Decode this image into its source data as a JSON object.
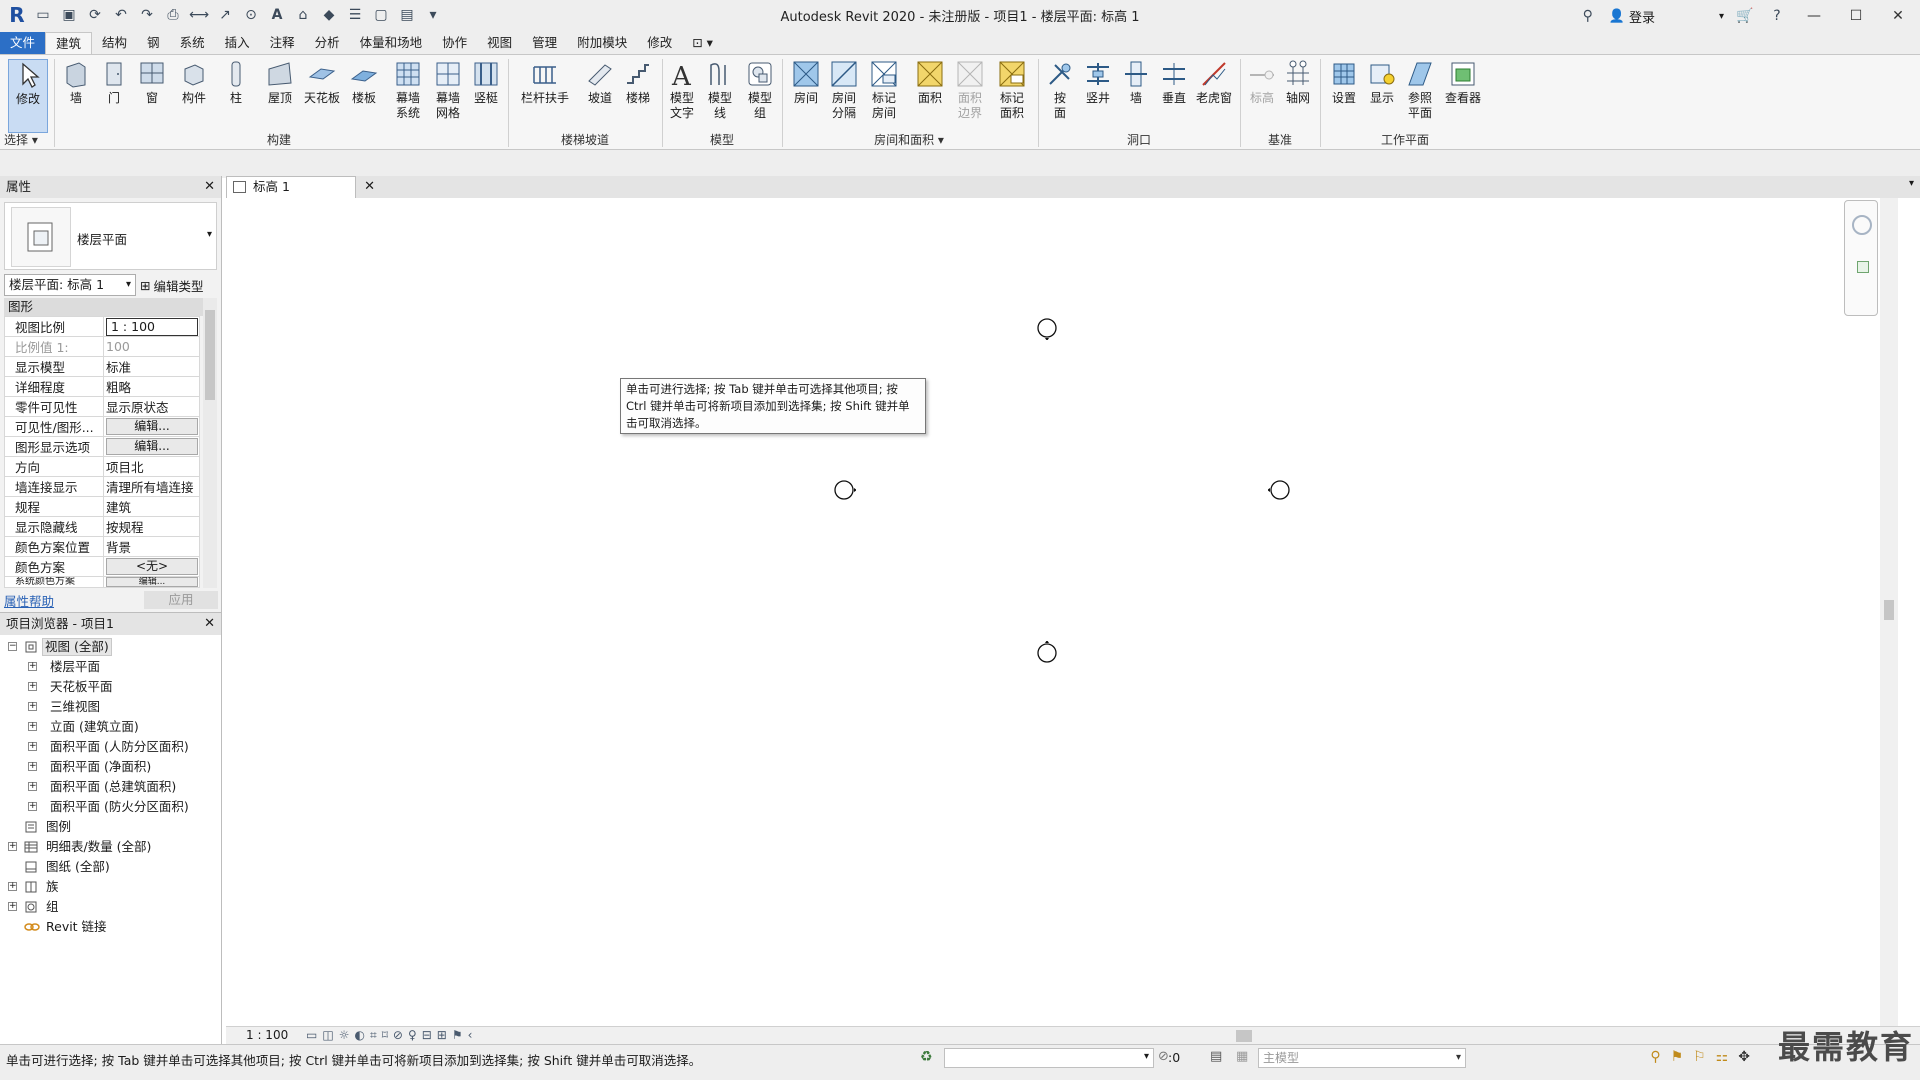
{
  "titlebar": {
    "title": "Autodesk Revit 2020 - 未注册版 - 项目1 - 楼层平面: 标高 1",
    "login": "登录"
  },
  "tabs": [
    "文件",
    "建筑",
    "结构",
    "钢",
    "系统",
    "插入",
    "注释",
    "分析",
    "体量和场地",
    "协作",
    "视图",
    "管理",
    "附加模块",
    "修改"
  ],
  "ribbon": {
    "modify": "修改",
    "select": "选择 ▾",
    "buttons": {
      "wall": "墙",
      "door": "门",
      "window": "窗",
      "component": "构件",
      "column": "柱",
      "roof": "屋顶",
      "ceiling": "天花板",
      "floor": "楼板",
      "curtain_system_1": "幕墙",
      "curtain_system_2": "系统",
      "curtain_grid_1": "幕墙",
      "curtain_grid_2": "网格",
      "mullion": "竖梃",
      "railing": "栏杆扶手",
      "ramp": "坡道",
      "stair": "楼梯",
      "model_text_1": "模型",
      "model_text_2": "文字",
      "model_line_1": "模型",
      "model_line_2": "线",
      "model_group_1": "模型",
      "model_group_2": "组",
      "room": "房间",
      "room_sep_1": "房间",
      "room_sep_2": "分隔",
      "tag_room_1": "标记",
      "tag_room_2": "房间",
      "area": "面积",
      "area_boundary_1": "面积",
      "area_boundary_2": "边界",
      "tag_area_1": "标记",
      "tag_area_2": "面积",
      "by_face_1": "按",
      "by_face_2": "面",
      "shaft": "竖井",
      "wall_opening": "墙",
      "vertical": "垂直",
      "dormer": "老虎窗",
      "level": "标高",
      "grid": "轴网",
      "set": "设置",
      "show": "显示",
      "ref_plane_1": "参照",
      "ref_plane_2": "平面",
      "viewer": "查看器"
    },
    "groups": {
      "build": "构建",
      "circulation": "楼梯坡道",
      "model": "模型",
      "room_area": "房间和面积 ▾",
      "opening": "洞口",
      "datum": "基准",
      "work_plane": "工作平面"
    }
  },
  "properties": {
    "title": "属性",
    "type_name": "楼层平面",
    "instance": "楼层平面: 标高 1",
    "edit_type": "编辑类型",
    "category": "图形",
    "rows": [
      {
        "label": "视图比例",
        "value": "1 : 100"
      },
      {
        "label": "比例值 1:",
        "value": "100"
      },
      {
        "label": "显示模型",
        "value": "标准"
      },
      {
        "label": "详细程度",
        "value": "粗略"
      },
      {
        "label": "零件可见性",
        "value": "显示原状态"
      },
      {
        "label": "可见性/图形...",
        "value": "编辑..."
      },
      {
        "label": "图形显示选项",
        "value": "编辑..."
      },
      {
        "label": "方向",
        "value": "项目北"
      },
      {
        "label": "墙连接显示",
        "value": "清理所有墙连接"
      },
      {
        "label": "规程",
        "value": "建筑"
      },
      {
        "label": "显示隐藏线",
        "value": "按规程"
      },
      {
        "label": "颜色方案位置",
        "value": "背景"
      },
      {
        "label": "颜色方案",
        "value": "<无>"
      },
      {
        "label": "系统颜色方案",
        "value": "编辑..."
      }
    ],
    "help": "属性帮助",
    "apply": "应用"
  },
  "browser": {
    "title": "项目浏览器 - 项目1",
    "root": "视图 (全部)",
    "views": [
      "楼层平面",
      "天花板平面",
      "三维视图",
      "立面 (建筑立面)",
      "面积平面 (人防分区面积)",
      "面积平面 (净面积)",
      "面积平面 (总建筑面积)",
      "面积平面 (防火分区面积)"
    ],
    "legend": "图例",
    "schedules": "明细表/数量 (全部)",
    "sheets": "图纸 (全部)",
    "families": "族",
    "groups": "组",
    "links": "Revit 链接"
  },
  "doc_tab": {
    "label": "标高 1"
  },
  "canvas": {
    "tooltip": "单击可进行选择; 按 Tab 键并单击可选择其他项目; 按 Ctrl 键并单击可将新项目添加到选择集; 按 Shift 键并单击可取消选择。"
  },
  "viewbar": {
    "scale": "1 : 100"
  },
  "statusbar": {
    "message": "单击可进行选择; 按 Tab 键并单击可选择其他项目; 按 Ctrl 键并单击可将新项目添加到选择集; 按 Shift 键并单击可取消选择。",
    "zero": ":0",
    "model": "主模型"
  },
  "watermark": "最需教育"
}
